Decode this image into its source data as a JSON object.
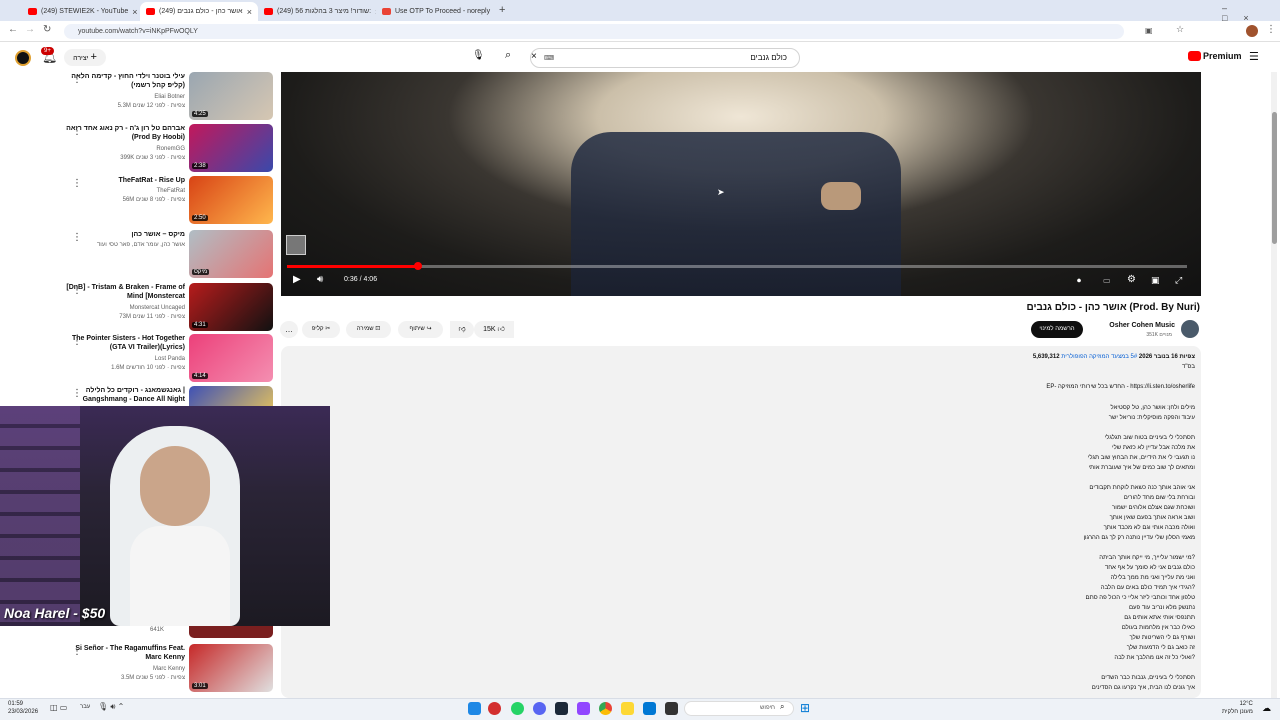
{
  "browser": {
    "tabs": [
      {
        "title": "(249) STEWIE2K - YouTube",
        "color": "#ff0000"
      },
      {
        "title": "(249) אושר כהן - כולם גנבים",
        "color": "#ff0000"
      },
      {
        "title": "(249) שודור! מיצר 3 בהלגות 56:",
        "color": "#ff0000"
      },
      {
        "title": "Use OTP To Proceed - noreply",
        "color": "#ea4335"
      }
    ],
    "url": "youtube.com/watch?v=iNKpPFwOQLY"
  },
  "youtube": {
    "create_label": "יצירה",
    "notifications_count": "9+",
    "search_value": "כולם גנבים",
    "premium_label": "Premium"
  },
  "recommendations": [
    {
      "title": "עילי בוטנר וילדי החוץ - קדימה הלאה (קליפ קהל רשמי)",
      "channel": "Eliai Botner",
      "stats": "5.3M צפיות · לפני 12 שנים",
      "duration": "4:25",
      "colors": [
        "#9aa6b1",
        "#d6c7b2"
      ]
    },
    {
      "title": "אברהם טל רון ג'ה - רק נאוג אחד רואה (Prod By Hoobi)",
      "channel": "RonemGG",
      "stats": "399K צפיות · לפני 3 שנים",
      "duration": "2:38",
      "colors": [
        "#c2185b",
        "#3949ab"
      ]
    },
    {
      "title": "TheFatRat - Rise Up",
      "channel": "TheFatRat",
      "stats": "56M צפיות · לפני 8 שנים",
      "duration": "2:50",
      "colors": [
        "#d84315",
        "#ffb74d"
      ]
    },
    {
      "title": "מיקס – אושר כהן",
      "channel": "אושר כהן, עומר אדם, פאר טסי ועוד",
      "stats": "",
      "duration": "מיקס",
      "colors": [
        "#b0bec5",
        "#e57373"
      ]
    },
    {
      "title": "[DnB] - Tristam & Braken - Frame of Mind [Monstercat",
      "channel": "Monstercat Uncaged",
      "stats": "73M צפיות · לפני 11 שנים",
      "duration": "4:31",
      "colors": [
        "#b71c1c",
        "#111111"
      ]
    },
    {
      "title": "The Pointer Sisters - Hot Together (GTA VI Trailer)(Lyrics)",
      "channel": "Lost Panda",
      "stats": "1.6M צפיות · לפני 10 חודשים",
      "duration": "4:14",
      "colors": [
        "#ec407a",
        "#f48fb1"
      ]
    },
    {
      "title": "גאנגשמאנג - רוקדים כל הלילה | Gangshmang - Dance All Night",
      "channel": "",
      "stats": "",
      "duration": "",
      "colors": [
        "#3f51b5",
        "#ffd54f"
      ]
    },
    {
      "title": "Si Señor - The Ragamuffins Feat. Marc Kenny",
      "channel": "Marc Kenny",
      "stats": "3.5M צפיות · לפני 5 שנים",
      "duration": "3:01",
      "colors": [
        "#c62828",
        "#e0e0e0"
      ]
    }
  ],
  "player": {
    "time": "0:36 / 4:06",
    "progress": 0.146
  },
  "video": {
    "title": "אושר כהן - כולם גנבים (Prod. By Nuri)",
    "channel": "Osher Cohen Music",
    "subscribers": "351K מנויים",
    "subscribe_label": "הרשמה למינוי",
    "likes": "15K",
    "share_label": "שיתוף",
    "save_label": "שמירה",
    "clip_label": "קליפ",
    "views": "5,639,312 צפיות",
    "date": "16 בנובר 2026",
    "hashtag": "5# במצעד המוזיקה הפופולרית",
    "bsd": "בס\"ד",
    "ep_line": "EP- החדש בכל שירותי המוזיקה - https://li.sten.to/osherlife",
    "credits": [
      "מילים ולחן: אושר כהן, טל קסטיאל",
      "עיבוד והפקה מוסיקלית: נוריאל ישר"
    ],
    "lyrics": [
      [
        "תסתכלי לי בעיניים בטוח שוב תגלגלי",
        "את מלכה אבל עדיין לא כזאת שלי",
        "נו תגעבי לי את הידיים, את הבחוץ שוב תגלי",
        "ומתאים לך שוב כמים של איך שעוברת אותי"
      ],
      [
        "אני אוהב אותך כנה כשאת לוקחת תקבודים",
        "ובורחת בלי שום מחד להורים",
        "ושוכחת שגם אצלם אלוהים ישמור",
        "ושוב אראה אותך בפעם שאין אותך",
        "ואולה מכבה אותי וגם לא מכבד אותך",
        "מאמי הסלון שלי עדיין נותנה רק לך גם ההרגון"
      ],
      [
        "מי ישמור עליייך, מי ייקח אותך הביתה?",
        "כולם גנבים אני לא סומך על אף אחד",
        "ואני מת עלייך ואני מת ממך בלילה",
        "הגידי איך תמיד כולם באים עם הלבה?",
        "טלפון אחד וכותבי ליזר אליי כי הכול פה סתם",
        "נתנשק מלא ונריב עוד פעם",
        "תתנפסי אותי אתא אותים גם",
        "כאילו כבר אין מלחמות בעולם",
        "ושורף גם לי השריטות שלך",
        "זה כואב גם לי הדמעות שלך",
        "ואולי כל זה אנו מהלבך את לבה?"
      ],
      [
        "תסתכלי לי בעיניים, גנבות כבר השדים",
        "איך גונים לנו הבית, איך נקרעו גם הסדינים"
      ]
    ]
  },
  "overlay": {
    "donation": "Noa Harel - $50"
  },
  "taskbar": {
    "time": "01:59",
    "date": "23/03/2026",
    "search_placeholder": "חיפוש",
    "weather_temp": "12°C",
    "weather_desc": "מעונן חלקית",
    "lang": "עבר"
  }
}
